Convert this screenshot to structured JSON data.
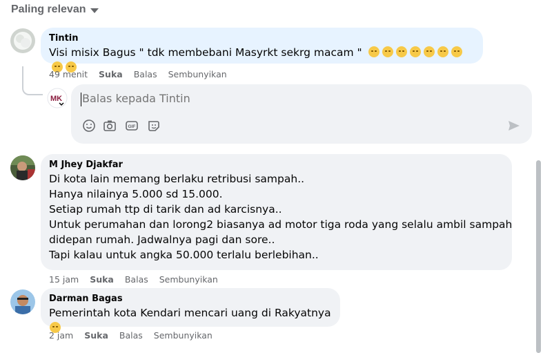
{
  "sort": {
    "label": "Paling relevan"
  },
  "comments": [
    {
      "author": "Tintin",
      "text_lines": [
        "Visi misix Bagus \" tdk membebani Masyrkt sekrg macam \""
      ],
      "time": "49 menit",
      "like": "Suka",
      "reply": "Balas",
      "hide": "Sembunyikan"
    },
    {
      "author": "M Jhey Djakfar",
      "text_lines": [
        "Di kota lain memang berlaku retribusi sampah..",
        "Hanya nilainya 5.000 sd 15.000.",
        "Setiap rumah ttp di tarik dan ad karcisnya..",
        "Untuk perumahan dan lorong2 biasanya ad motor tiga roda yang selalu ambil sampah",
        "didepan rumah. Jadwalnya pagi dan sore..",
        "Tapi kalau untuk angka 50.000 terlalu berlebihan.."
      ],
      "time": "15 jam",
      "like": "Suka",
      "reply": "Balas",
      "hide": "Sembunyikan"
    },
    {
      "author": "Darman Bagas",
      "text_lines": [
        "Pemerintah kota Kendari mencari uang di Rakyatnya"
      ],
      "time": "2 jam",
      "like": "Suka",
      "reply": "Balas",
      "hide": "Sembunyikan"
    }
  ],
  "reply_box": {
    "placeholder": "Balas kepada Tintin",
    "avatar_text": "MK"
  },
  "colors": {
    "bubble": "#f0f2f5",
    "highlight_bubble": "#e7f3ff",
    "secondary_text": "#65676b"
  }
}
